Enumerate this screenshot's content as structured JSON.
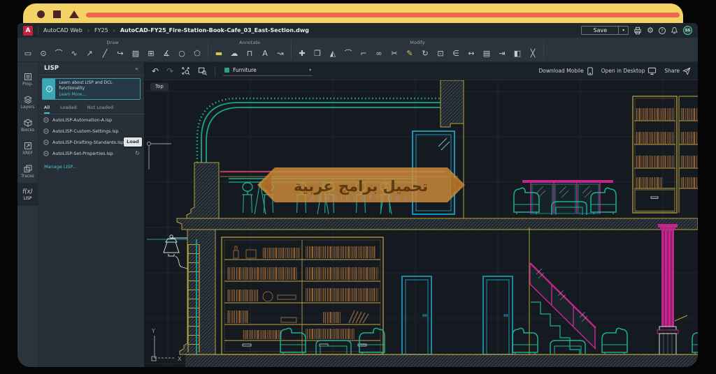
{
  "window_controls": {
    "shapes": [
      "circle",
      "square",
      "triangle"
    ]
  },
  "titlebar": {
    "logo": "A",
    "breadcrumb": [
      "AutoCAD Web",
      "FY25",
      "AutoCAD-FY25_Fire-Station-Book-Cafe_03_East-Section.dwg"
    ],
    "separator": "›",
    "save_label": "Save",
    "save_caret": "▾",
    "gear_glyph": "⚙",
    "help_glyph": "?",
    "avatar": "SS"
  },
  "ribbon": {
    "groups": [
      {
        "label": "Draw",
        "icons": [
          {
            "name": "rectangle",
            "glyph": "▭"
          },
          {
            "name": "circle",
            "glyph": "⊙"
          },
          {
            "name": "arc",
            "glyph": "⌒"
          },
          {
            "name": "spline",
            "glyph": "∿"
          },
          {
            "name": "ray",
            "glyph": "↗"
          },
          {
            "name": "line",
            "glyph": "╱"
          },
          {
            "name": "revision-arc",
            "glyph": "↪"
          },
          {
            "name": "hatch",
            "glyph": "▨"
          },
          {
            "name": "array",
            "glyph": "⊞"
          },
          {
            "name": "angle",
            "glyph": "∡"
          },
          {
            "name": "ellipse",
            "glyph": "○"
          },
          {
            "name": "polygon",
            "glyph": "⬠"
          }
        ]
      },
      {
        "label": "Annotate",
        "icons": [
          {
            "name": "multiline",
            "glyph": "▬"
          },
          {
            "name": "revision-cloud",
            "glyph": "☁"
          },
          {
            "name": "dimension",
            "glyph": "⊓"
          },
          {
            "name": "text",
            "glyph": "A"
          },
          {
            "name": "leader",
            "glyph": "↝"
          }
        ]
      },
      {
        "label": "Modify",
        "icons": [
          {
            "name": "move",
            "glyph": "✚"
          },
          {
            "name": "copy",
            "glyph": "❐"
          },
          {
            "name": "mirror",
            "glyph": "◭"
          },
          {
            "name": "fillet",
            "glyph": "⌒"
          },
          {
            "name": "chamfer",
            "glyph": "⌐"
          },
          {
            "name": "match-properties",
            "glyph": "∞"
          },
          {
            "name": "trim",
            "glyph": "✂"
          },
          {
            "name": "edit",
            "glyph": "✎"
          },
          {
            "name": "rotate",
            "glyph": "↻"
          },
          {
            "name": "scale",
            "glyph": "⊡"
          },
          {
            "name": "offset",
            "glyph": "∈"
          },
          {
            "name": "stretch",
            "glyph": "↔"
          },
          {
            "name": "save-block",
            "glyph": "▤"
          },
          {
            "name": "export",
            "glyph": "⇥"
          },
          {
            "name": "extrude",
            "glyph": "◧"
          },
          {
            "name": "break",
            "glyph": "╳"
          }
        ]
      }
    ]
  },
  "sidebar": {
    "items": [
      {
        "label": "Prop."
      },
      {
        "label": "Layers"
      },
      {
        "label": "Blocks"
      },
      {
        "label": "XREF"
      },
      {
        "label": "Traces"
      },
      {
        "label": "LISP"
      }
    ]
  },
  "lisp_panel": {
    "title": "LISP",
    "collapse": "«",
    "banner": {
      "text": "Learn about LISP and DCL functionality",
      "link": "Learn More..."
    },
    "tabs": [
      {
        "label": "All"
      },
      {
        "label": "Loaded"
      },
      {
        "label": "Not Loaded"
      }
    ],
    "files": [
      {
        "name": "AutoLISP-Automation-A.lsp"
      },
      {
        "name": "AutoLISP-Custom-Settings.lsp"
      },
      {
        "name": "AutoLISP-Drafting-Standards.lsp"
      },
      {
        "name": "AutoLISP-Set-Properties.lsp"
      }
    ],
    "load_button": "Load",
    "refresh_glyph": "↻",
    "manage_link": "Manage LISP..."
  },
  "canvas_toolbar": {
    "undo_glyph": "↶",
    "redo_glyph": "↷",
    "layer_selector": "Furniture",
    "dd_caret": "▾",
    "download_mobile": "Download Mobile",
    "open_desktop": "Open in Desktop",
    "share": "Share"
  },
  "viewport": {
    "view_tab": "Top",
    "ucs_x": "X",
    "ucs_y": "Y",
    "watermark_arabic": "تحميل برامج عربية",
    "watermark_latin": "ARABICSOFT.ORG"
  },
  "colors": {
    "accent_teal": "#1fae96",
    "cad_yellow": "#b9a23a",
    "cad_magenta": "#c2258c",
    "cad_cyan": "#1d93b4",
    "cad_brown": "#8f6136",
    "ui_teal": "#3fc1c9",
    "banner_orange": "#cf8c3c",
    "chrome_yellow": "#f3d366",
    "chrome_orange": "#f1664b",
    "logo_red": "#c32040"
  }
}
